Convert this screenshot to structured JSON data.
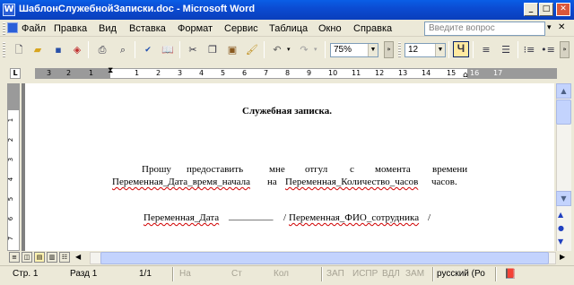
{
  "window": {
    "title": "ШаблонСлужебнойЗаписки.doc - Microsoft Word",
    "icon_label": "W",
    "minimize_glyph": "_",
    "maximize_glyph": "□",
    "close_glyph": "✕"
  },
  "menu": {
    "items": [
      "Файл",
      "Правка",
      "Вид",
      "Вставка",
      "Формат",
      "Сервис",
      "Таблица",
      "Окно",
      "Справка"
    ],
    "help_placeholder": "Введите вопрос",
    "close_glyph": "✕"
  },
  "toolbar": {
    "icons": [
      "new-document-icon",
      "open-folder-icon",
      "save-icon",
      "permission-icon",
      "print-icon",
      "print-preview-icon",
      "spelling-icon",
      "research-icon",
      "cut-icon",
      "copy-icon",
      "paste-icon",
      "format-painter-icon",
      "undo-icon",
      "redo-icon"
    ],
    "zoom": "75%",
    "font_size": "12",
    "bold_label": "Ч"
  },
  "ruler": {
    "corner_label": "L",
    "numbers": [
      "3",
      "2",
      "1",
      "1",
      "2",
      "3",
      "4",
      "5",
      "6",
      "7",
      "8",
      "9",
      "10",
      "11",
      "12",
      "13",
      "14",
      "15",
      "16",
      "17"
    ]
  },
  "vruler": {
    "numbers": [
      "1",
      "2",
      "3",
      "4",
      "5",
      "6",
      "7"
    ]
  },
  "document": {
    "title": "Служебная записка.",
    "para1_words": [
      "Прошу",
      "предоставить",
      "мне",
      "отгул",
      "с",
      "момента",
      "времени"
    ],
    "line2_field1": "Переменная_Дата_время_начала",
    "line2_na": "на",
    "line2_field2": "Переменная_Количество_часов",
    "line2_end": "часов.",
    "sign_date": "Переменная_Дата",
    "sign_blank": "_________",
    "sign_slash": "/",
    "sign_name": "Переменная_ФИО_сотрудника",
    "sign_slash_end": "/"
  },
  "status": {
    "page": "Стр.   1",
    "section": "Разд  1",
    "pages": "1/1",
    "at": "На",
    "line": "Ст",
    "col": "Кол",
    "rec": "ЗАП",
    "trk": "ИСПР",
    "ext": "ВДЛ",
    "ovr": "ЗАМ",
    "language": "русский (Ро"
  }
}
